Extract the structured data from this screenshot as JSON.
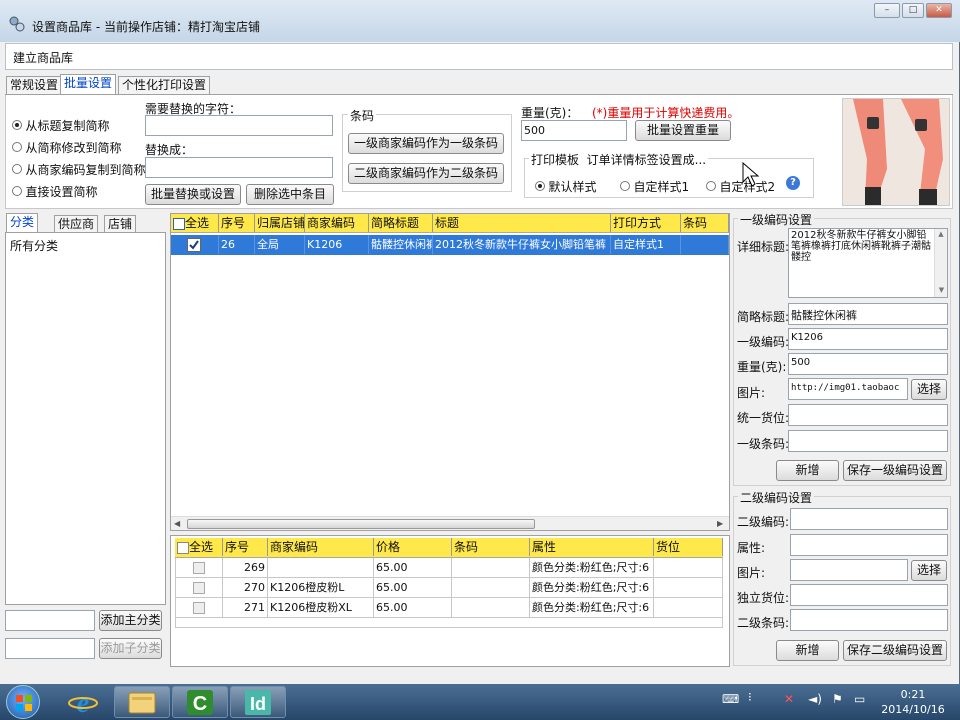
{
  "window": {
    "title": "设置商品库 - 当前操作店铺：精打淘宝店铺",
    "btn_min": "–",
    "btn_max": "□",
    "btn_close": "✕"
  },
  "menu": {
    "build": "建立商品库"
  },
  "tabs": [
    {
      "label": "常规设置",
      "active": false
    },
    {
      "label": "批量设置",
      "active": true
    },
    {
      "label": "个性化打印设置",
      "active": false
    }
  ],
  "batch": {
    "radios": [
      {
        "label": "从标题复制简称",
        "checked": true
      },
      {
        "label": "从简称修改到简称",
        "checked": false
      },
      {
        "label": "从商家编码复制到简称",
        "checked": false
      },
      {
        "label": "直接设置简称",
        "checked": false
      }
    ],
    "replace_label": "需要替换的字符：",
    "replace_with_label": "替换成：",
    "replace_button": "批量替换或设置",
    "delete_button": "删除选中条目",
    "barcode_title": "条码",
    "barcode_btn1": "一级商家编码作为一级条码",
    "barcode_btn2": "二级商家编码作为二级条码",
    "weight_label": "重量(克)：",
    "weight_note": "(*)重量用于计算快递费用。",
    "weight_value": "500",
    "weight_button": "批量设置重量",
    "print_title": "打印模板",
    "print_subtitle": "订单详情标签设置成...",
    "print_radios": [
      {
        "label": "默认样式",
        "checked": true
      },
      {
        "label": "自定样式1",
        "checked": false
      },
      {
        "label": "自定样式2",
        "checked": false
      }
    ],
    "help_icon": "?"
  },
  "left_tabs": [
    "分类",
    "供应商",
    "店铺"
  ],
  "category_tree": {
    "root": "所有分类"
  },
  "left_buttons": {
    "add_main": "添加主分类",
    "add_sub": "添加子分类"
  },
  "main_grid": {
    "columns": [
      "全选",
      "序号",
      "归属店铺",
      "商家编码",
      "简略标题",
      "标题",
      "打印方式",
      "条码"
    ],
    "rows": [
      {
        "index": "26",
        "shop": "全局",
        "code": "K1206",
        "short": "骷髅控休闲裤",
        "title": "2012秋冬新款牛仔裤女小脚铅笔裤",
        "print": "自定样式1",
        "barcode": ""
      }
    ]
  },
  "sub_grid": {
    "columns": [
      "全选",
      "序号",
      "商家编码",
      "价格",
      "条码",
      "属性",
      "货位"
    ],
    "rows": [
      {
        "index": "269",
        "code": "",
        "price": "65.00",
        "barcode": "",
        "attr": "颜色分类:粉红色;尺寸:6",
        "loc": ""
      },
      {
        "index": "270",
        "code": "K1206橙皮粉L",
        "price": "65.00",
        "barcode": "",
        "attr": "颜色分类:粉红色;尺寸:6",
        "loc": ""
      },
      {
        "index": "271",
        "code": "K1206橙皮粉XL",
        "price": "65.00",
        "barcode": "",
        "attr": "颜色分类:粉红色;尺寸:6",
        "loc": ""
      }
    ]
  },
  "level1": {
    "title": "一级编码设置",
    "detail_label": "详细标题:",
    "detail_value": "2012秋冬新款牛仔裤女小脚铅笔裤橡裤打底休闲裤靴裤子潮骷髅控",
    "short_label": "简略标题:",
    "short_value": "骷髅控休闲裤",
    "code_label": "一级编码:",
    "code_value": "K1206",
    "weight_label": "重量(克):",
    "weight_value": "500",
    "image_label": "图片:",
    "image_value": "http://img01.taobaoc",
    "choose_button": "选择",
    "location_label": "统一货位:",
    "barcode_label": "一级条码:",
    "add_button": "新增",
    "save_button": "保存一级编码设置"
  },
  "level2": {
    "title": "二级编码设置",
    "code_label": "二级编码:",
    "attr_label": "属性:",
    "image_label": "图片:",
    "choose_button": "选择",
    "location_label": "独立货位:",
    "barcode_label": "二级条码:",
    "add_button": "新增",
    "save_button": "保存二级编码设置"
  },
  "taskbar": {
    "time": "0:21",
    "date": "2014/10/16",
    "apps": [
      "ie-icon",
      "explorer-icon",
      "camtasia-icon",
      "indesign-icon"
    ]
  }
}
